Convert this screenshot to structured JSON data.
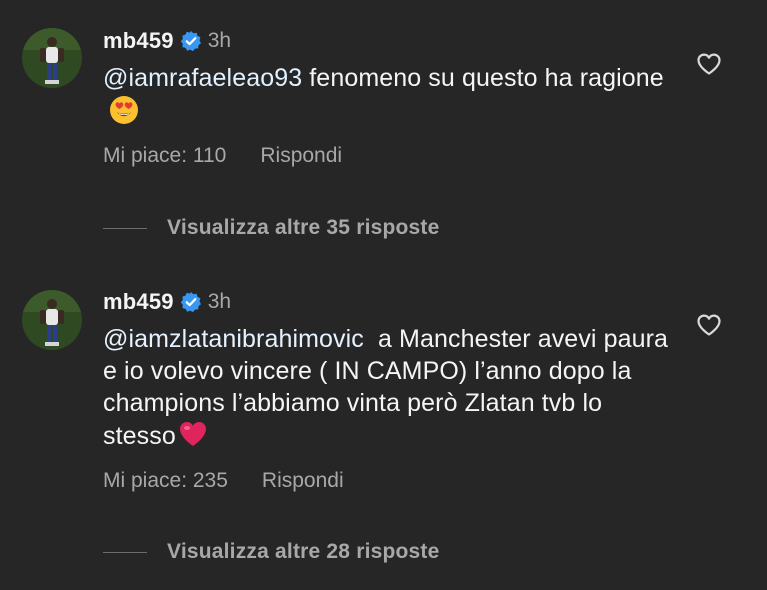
{
  "comments": [
    {
      "username": "mb459",
      "time": "3h",
      "mention": "@iamrafaeleao93",
      "text": " fenomeno su questo ha ragione",
      "emoji": "heart-eyes-emoji",
      "likes_label": "Mi piace: 110",
      "reply_label": "Rispondi",
      "more_replies_label": "Visualizza altre 35 risposte"
    },
    {
      "username": "mb459",
      "time": "3h",
      "mention": "@iamzlatanibrahimovic",
      "text": "  a Manchester avevi paura e io volevo vincere ( IN CAMPO) l’anno dopo la champions l’abbiamo vinta però Zlatan tvb lo stesso",
      "emoji": "red-heart-emoji",
      "likes_label": "Mi piace: 235",
      "reply_label": "Rispondi",
      "more_replies_label": "Visualizza altre 28 risposte"
    }
  ],
  "colors": {
    "background": "#262626",
    "text": "#f5f5f5",
    "secondary": "#a8a8a8",
    "verified": "#3897f0",
    "heart_emoji": "#e0245e"
  }
}
